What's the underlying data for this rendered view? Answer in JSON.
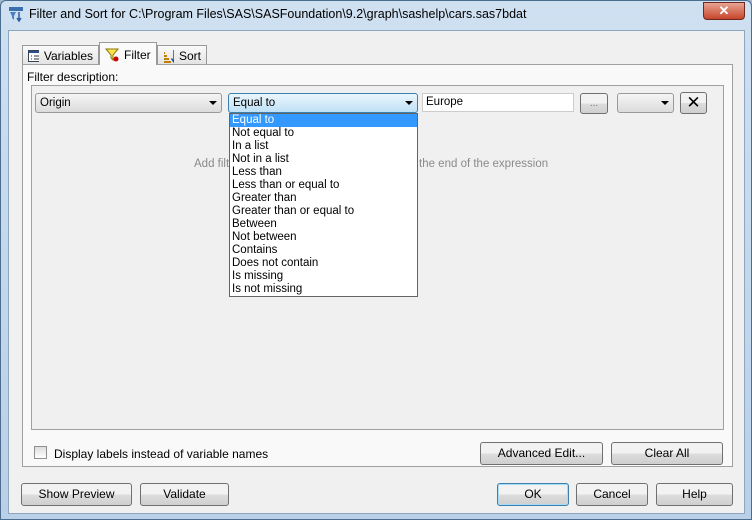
{
  "window": {
    "title": "Filter and Sort for C:\\Program Files\\SAS\\SASFoundation\\9.2\\graph\\sashelp\\cars.sas7bdat",
    "close": "✕"
  },
  "tabs": [
    {
      "label": "Variables",
      "icon": "variables-icon"
    },
    {
      "label": "Filter",
      "icon": "filter-funnel-icon",
      "active": true
    },
    {
      "label": "Sort",
      "icon": "sort-icon"
    }
  ],
  "filter": {
    "description_label": "Filter description:",
    "variable": "Origin",
    "operator": "Equal to",
    "value": "Europe",
    "browse_label": "...",
    "connector": "",
    "delete": "✕",
    "operator_options": [
      "Equal to",
      "Not equal to",
      "In a list",
      "Not in a list",
      "Less than",
      "Less than or equal to",
      "Greater than",
      "Greater than or equal to",
      "Between",
      "Not between",
      "Contains",
      "Does not contain",
      "Is missing",
      "Is not missing"
    ],
    "hint_left": "Add filte",
    "hint_right": "the end of the expression"
  },
  "options": {
    "display_labels": "Display labels instead of variable names",
    "display_labels_checked": false
  },
  "buttons": {
    "advanced_edit": "Advanced Edit...",
    "clear_all": "Clear All",
    "show_preview": "Show Preview",
    "validate": "Validate",
    "ok": "OK",
    "cancel": "Cancel",
    "help": "Help"
  }
}
